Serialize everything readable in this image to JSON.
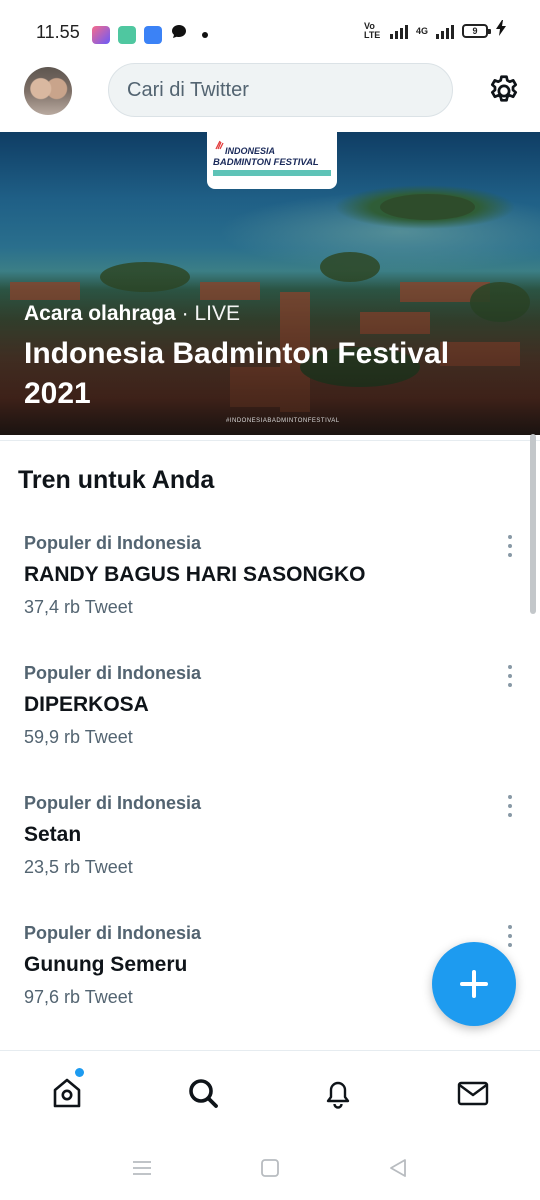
{
  "status_bar": {
    "time": "11.55",
    "volte": "Vo LTE",
    "network": "4G",
    "battery": "9"
  },
  "header": {
    "search_placeholder": "Cari di Twitter",
    "avatar_icon": "user-avatar",
    "settings_icon": "gear-icon"
  },
  "hero": {
    "category": "Acara olahraga",
    "separator": "·",
    "status": "LIVE",
    "title": "Indonesia Badminton Festival 2021",
    "logo_line1": "INDONESIA",
    "logo_line2": "BADMINTON FESTIVAL",
    "hashtag": "#INDONESIABADMINTONFESTIVAL"
  },
  "section_title": "Tren untuk Anda",
  "trends": [
    {
      "context": "Populer di Indonesia",
      "name": "RANDY BAGUS HARI SASONGKO",
      "count": "37,4 rb Tweet"
    },
    {
      "context": "Populer di Indonesia",
      "name": "DIPERKOSA",
      "count": "59,9 rb Tweet"
    },
    {
      "context": "Populer di Indonesia",
      "name": "Setan",
      "count": "23,5 rb Tweet"
    },
    {
      "context": "Populer di Indonesia",
      "name": "Gunung Semeru",
      "count": "97,6 rb Tweet"
    }
  ],
  "fab_icon": "plus-icon",
  "bottom_nav": [
    {
      "icon": "home-icon",
      "has_notification": true
    },
    {
      "icon": "search-icon",
      "active": true
    },
    {
      "icon": "bell-icon"
    },
    {
      "icon": "mail-icon"
    }
  ],
  "colors": {
    "accent": "#1d9bf0",
    "secondary_text": "#536471",
    "primary_text": "#0f1419"
  }
}
